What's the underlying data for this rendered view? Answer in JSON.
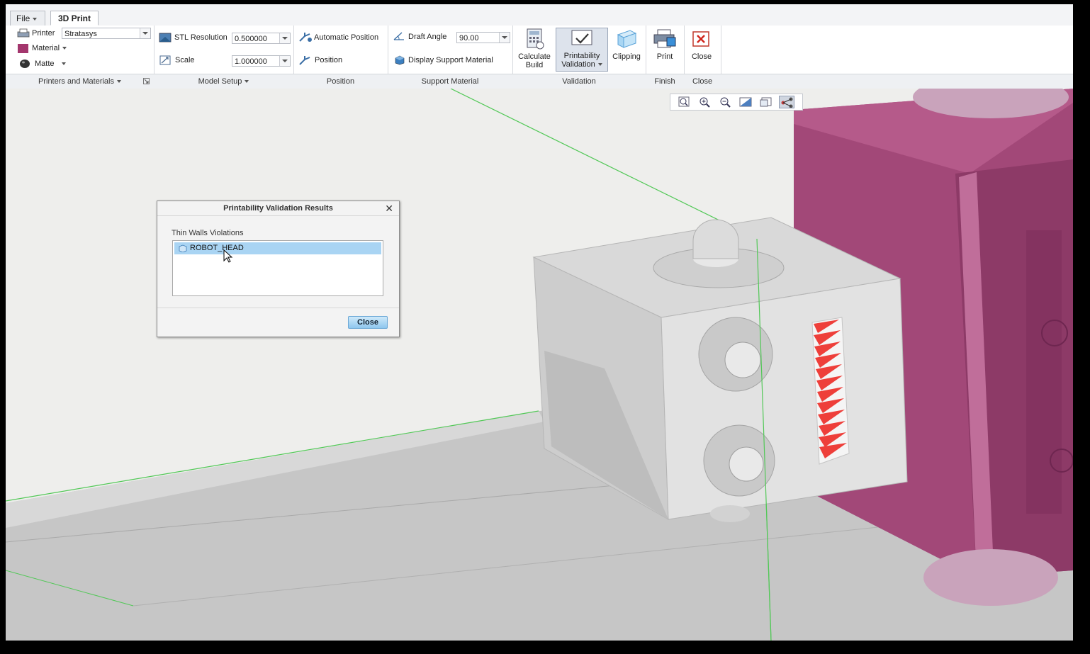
{
  "tabs": {
    "file": "File",
    "active": "3D Print"
  },
  "printers": {
    "printer_label": "Printer",
    "printer_value": "Stratasys",
    "material_label": "Material",
    "finish_label": "Matte",
    "group_label": "Printers and Materials"
  },
  "model_setup": {
    "stl_label": "STL Resolution",
    "stl_value": "0.500000",
    "scale_label": "Scale",
    "scale_value": "1.000000",
    "group_label": "Model Setup"
  },
  "position": {
    "auto_label": "Automatic Position",
    "position_label": "Position",
    "group_label": "Position"
  },
  "support": {
    "draft_label": "Draft Angle",
    "draft_value": "90.00",
    "display_label": "Display Support Material",
    "group_label": "Support Material"
  },
  "validation": {
    "calc_line1": "Calculate",
    "calc_line2": "Build",
    "pv_line1": "Printability",
    "pv_line2": "Validation",
    "clipping": "Clipping",
    "group_label": "Validation"
  },
  "finish": {
    "print": "Print",
    "group_label": "Finish"
  },
  "close_group": {
    "close": "Close",
    "group_label": "Close"
  },
  "dialog": {
    "title": "Printability Validation Results",
    "subtitle": "Thin Walls Violations",
    "item": "ROBOT_HEAD",
    "close_button": "Close"
  },
  "colors": {
    "material_swatch": "#a3366d",
    "housing": "#a24878",
    "model_gray": "#d9d9d9",
    "violation": "#ee3f3a",
    "build_frame": "#52c857"
  }
}
